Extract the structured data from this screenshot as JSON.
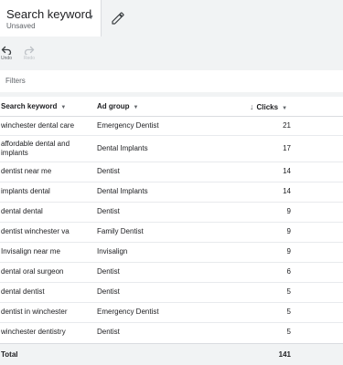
{
  "header": {
    "title": "Search keyword",
    "status": "Unsaved",
    "caret_icon": "dropdown-caret-icon",
    "edit_icon": "pencil-icon"
  },
  "toolbar": {
    "undo_label": "Undo",
    "redo_label": "Redo"
  },
  "filters": {
    "label": "Filters"
  },
  "table": {
    "columns": {
      "keyword": "Search keyword",
      "ad_group": "Ad group",
      "clicks": "Clicks"
    },
    "sorted_column": "Clicks",
    "rows": [
      {
        "keyword": "winchester dental care",
        "ad_group": "Emergency Dentist",
        "clicks": "21"
      },
      {
        "keyword": "affordable dental and implants",
        "ad_group": "Dental Implants",
        "clicks": "17"
      },
      {
        "keyword": "dentist near me",
        "ad_group": "Dentist",
        "clicks": "14"
      },
      {
        "keyword": "implants dental",
        "ad_group": "Dental Implants",
        "clicks": "14"
      },
      {
        "keyword": "dental dental",
        "ad_group": "Dentist",
        "clicks": "9"
      },
      {
        "keyword": "dentist winchester va",
        "ad_group": "Family Dentist",
        "clicks": "9"
      },
      {
        "keyword": "Invisalign near me",
        "ad_group": "Invisalign",
        "clicks": "9"
      },
      {
        "keyword": "dental oral surgeon",
        "ad_group": "Dentist",
        "clicks": "6"
      },
      {
        "keyword": "dental dentist",
        "ad_group": "Dentist",
        "clicks": "5"
      },
      {
        "keyword": "dentist in winchester",
        "ad_group": "Emergency Dentist",
        "clicks": "5"
      },
      {
        "keyword": "winchester dentistry",
        "ad_group": "Dentist",
        "clicks": "5"
      }
    ],
    "total": {
      "label": "Total",
      "clicks": "141"
    }
  }
}
